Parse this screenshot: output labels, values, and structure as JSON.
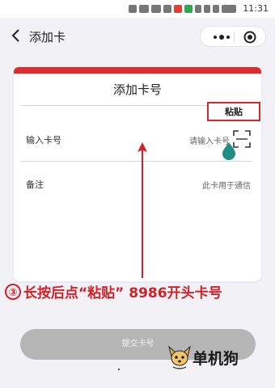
{
  "status_bar": {
    "time": "11:31"
  },
  "nav": {
    "title": "添加卡"
  },
  "card": {
    "title": "添加卡号",
    "paste_label": "粘贴",
    "card_number": {
      "label": "输入卡号",
      "placeholder": "请输入卡号"
    },
    "note": {
      "label": "备注",
      "value": "此卡用于通信"
    }
  },
  "annotation": {
    "step": "③",
    "text": "长按后点“粘贴” 8986开头卡号"
  },
  "submit_label": "提交卡号",
  "watermark": {
    "text": "单机狗"
  },
  "colors": {
    "accent_red": "#e12b2b",
    "annotation_red": "#d52028",
    "drop_teal": "#1f8e86",
    "button_gray": "#b6b6b6"
  },
  "icons": {
    "back": "chevron-left-icon",
    "more": "more-dots-icon",
    "close_target": "target-circle-icon",
    "scan": "scan-frame-icon",
    "cursor": "teardrop-cursor-icon",
    "arrow": "arrow-up-icon",
    "mascot": "dog-logo-icon"
  }
}
